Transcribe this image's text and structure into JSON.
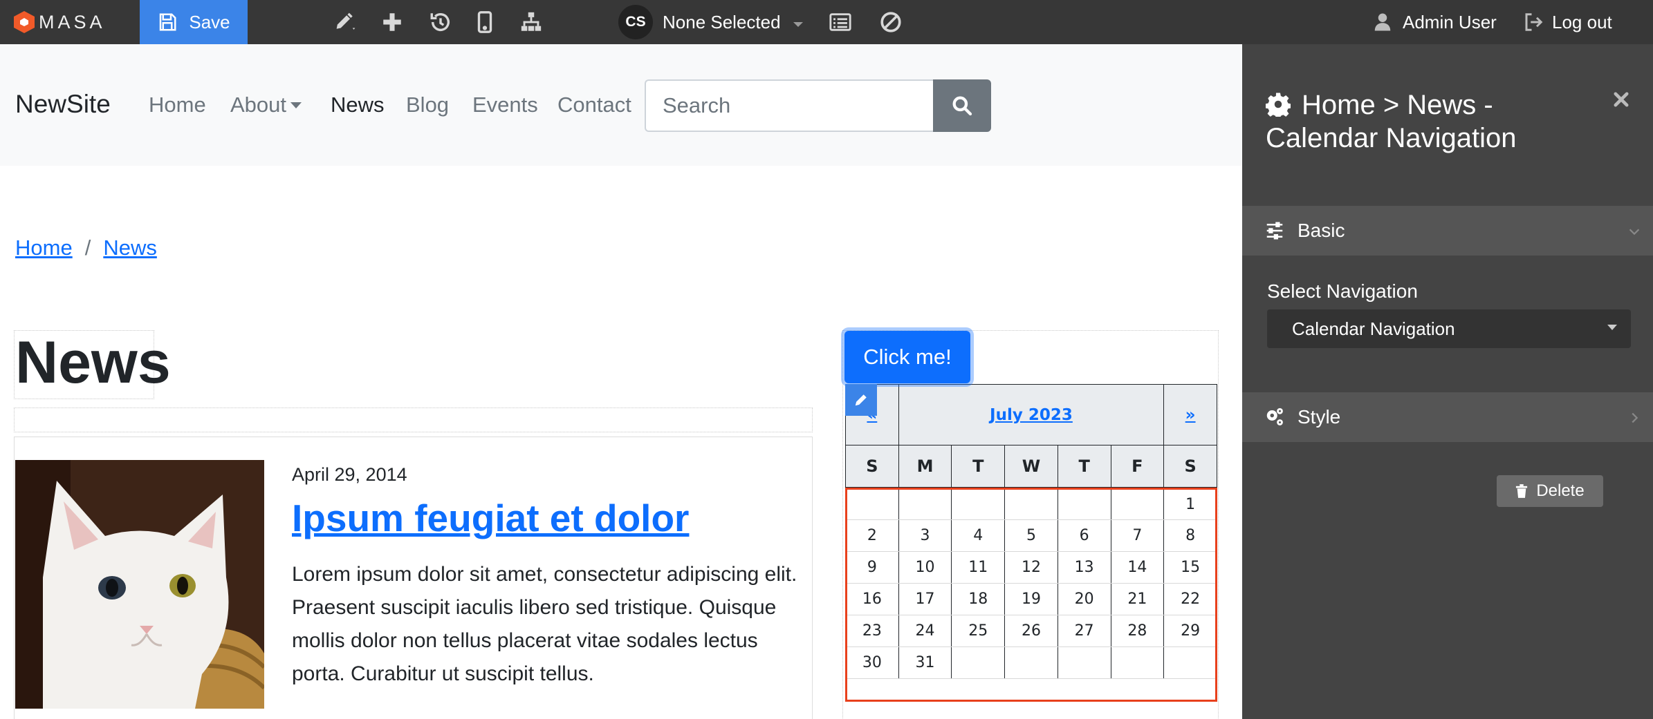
{
  "toolbar": {
    "brand": "MASA",
    "save_label": "Save",
    "tools": [
      "pencil-icon",
      "plus-icon",
      "history-icon",
      "mobile-icon",
      "sitemap-icon"
    ],
    "content_selector": {
      "initials": "CS",
      "label": "None Selected"
    },
    "extra_tools": [
      "list-icon",
      "ban-icon"
    ],
    "user_label": "Admin User",
    "logout_label": "Log out"
  },
  "navbar": {
    "site_name": "NewSite",
    "items": [
      {
        "label": "Home",
        "active": false
      },
      {
        "label": "About",
        "active": false,
        "dropdown": true
      },
      {
        "label": "News",
        "active": true
      },
      {
        "label": "Blog",
        "active": false
      },
      {
        "label": "Events",
        "active": false
      },
      {
        "label": "Contact",
        "active": false
      }
    ],
    "search": {
      "placeholder": "Search",
      "value": ""
    }
  },
  "breadcrumb": [
    "Home",
    "News"
  ],
  "page": {
    "title": "News",
    "article": {
      "date": "April 29, 2014",
      "title": "Ipsum feugiat et dolor",
      "body": "Lorem ipsum dolor sit amet, consectetur adipiscing elit. Praesent suscipit iaculis libero sed tristique. Quisque mollis dolor non tellus placerat vitae sodales lectus porta. Curabitur ut suscipit tellus.",
      "image": "white-cat-photo"
    }
  },
  "calendar_widget": {
    "button_label": "Click me!",
    "prev": "«",
    "next": "»",
    "month": "July 2023",
    "weekdays": [
      "S",
      "M",
      "T",
      "W",
      "T",
      "F",
      "S"
    ],
    "weeks": [
      [
        "",
        "",
        "",
        "",
        "",
        "",
        "1"
      ],
      [
        "2",
        "3",
        "4",
        "5",
        "6",
        "7",
        "8"
      ],
      [
        "9",
        "10",
        "11",
        "12",
        "13",
        "14",
        "15"
      ],
      [
        "16",
        "17",
        "18",
        "19",
        "20",
        "21",
        "22"
      ],
      [
        "23",
        "24",
        "25",
        "26",
        "27",
        "28",
        "29"
      ],
      [
        "30",
        "31",
        "",
        "",
        "",
        "",
        ""
      ]
    ]
  },
  "panel": {
    "title": "Home > News - Calendar Navigation",
    "sections": {
      "basic": "Basic",
      "style": "Style"
    },
    "select_label": "Select Navigation",
    "select_value": "Calendar Navigation",
    "delete_label": "Delete"
  },
  "colors": {
    "toolbar_bg": "#373737",
    "save_bg": "#3b84e8",
    "accent": "#0d6efd",
    "brand_orange": "#f15a29",
    "panel_bg": "#444444",
    "selection_outline": "#e8401c"
  }
}
